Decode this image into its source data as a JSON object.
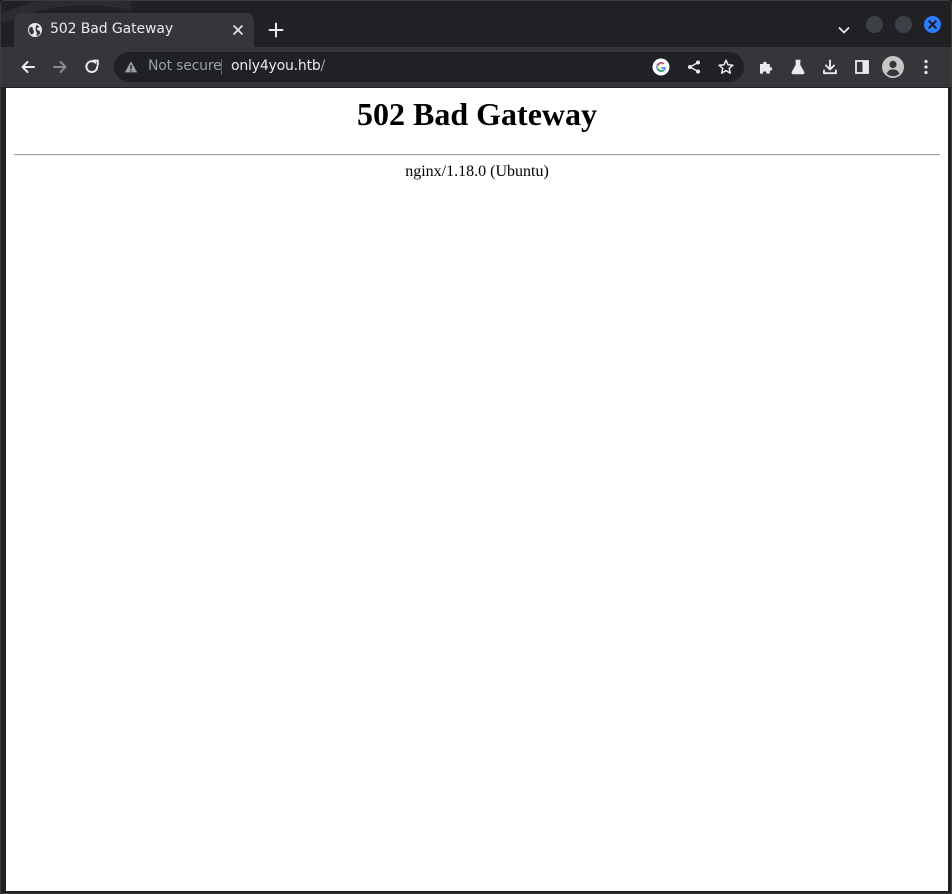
{
  "browser": {
    "tab": {
      "title": "502 Bad Gateway",
      "favicon": "globe-icon"
    },
    "omnibox": {
      "security_label": "Not secure",
      "url_host": "only4you.htb",
      "url_path": "/"
    },
    "icons": {
      "back": "arrow-left-icon",
      "forward": "arrow-right-icon",
      "reload": "reload-icon",
      "google": "google-icon",
      "share": "share-icon",
      "bookmark": "star-icon",
      "extensions": "puzzle-icon",
      "labs": "flask-icon",
      "downloads": "download-icon",
      "side_panel": "side-panel-icon",
      "profile": "avatar-icon",
      "menu": "kebab-menu-icon"
    },
    "colors": {
      "frame": "#202124",
      "toolbar": "#35363a",
      "close_button": "#2f7bff"
    }
  },
  "page": {
    "heading": "502 Bad Gateway",
    "server": "nginx/1.18.0 (Ubuntu)"
  }
}
